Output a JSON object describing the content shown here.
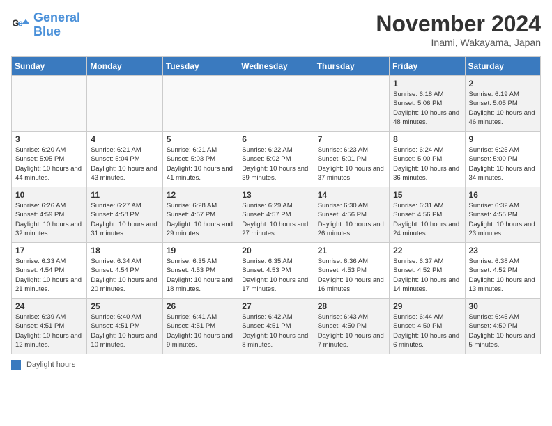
{
  "header": {
    "logo_line1": "General",
    "logo_line2": "Blue",
    "month": "November 2024",
    "location": "Inami, Wakayama, Japan"
  },
  "weekdays": [
    "Sunday",
    "Monday",
    "Tuesday",
    "Wednesday",
    "Thursday",
    "Friday",
    "Saturday"
  ],
  "weeks": [
    [
      {
        "day": "",
        "info": ""
      },
      {
        "day": "",
        "info": ""
      },
      {
        "day": "",
        "info": ""
      },
      {
        "day": "",
        "info": ""
      },
      {
        "day": "",
        "info": ""
      },
      {
        "day": "1",
        "info": "Sunrise: 6:18 AM\nSunset: 5:06 PM\nDaylight: 10 hours and 48 minutes."
      },
      {
        "day": "2",
        "info": "Sunrise: 6:19 AM\nSunset: 5:05 PM\nDaylight: 10 hours and 46 minutes."
      }
    ],
    [
      {
        "day": "3",
        "info": "Sunrise: 6:20 AM\nSunset: 5:05 PM\nDaylight: 10 hours and 44 minutes."
      },
      {
        "day": "4",
        "info": "Sunrise: 6:21 AM\nSunset: 5:04 PM\nDaylight: 10 hours and 43 minutes."
      },
      {
        "day": "5",
        "info": "Sunrise: 6:21 AM\nSunset: 5:03 PM\nDaylight: 10 hours and 41 minutes."
      },
      {
        "day": "6",
        "info": "Sunrise: 6:22 AM\nSunset: 5:02 PM\nDaylight: 10 hours and 39 minutes."
      },
      {
        "day": "7",
        "info": "Sunrise: 6:23 AM\nSunset: 5:01 PM\nDaylight: 10 hours and 37 minutes."
      },
      {
        "day": "8",
        "info": "Sunrise: 6:24 AM\nSunset: 5:00 PM\nDaylight: 10 hours and 36 minutes."
      },
      {
        "day": "9",
        "info": "Sunrise: 6:25 AM\nSunset: 5:00 PM\nDaylight: 10 hours and 34 minutes."
      }
    ],
    [
      {
        "day": "10",
        "info": "Sunrise: 6:26 AM\nSunset: 4:59 PM\nDaylight: 10 hours and 32 minutes."
      },
      {
        "day": "11",
        "info": "Sunrise: 6:27 AM\nSunset: 4:58 PM\nDaylight: 10 hours and 31 minutes."
      },
      {
        "day": "12",
        "info": "Sunrise: 6:28 AM\nSunset: 4:57 PM\nDaylight: 10 hours and 29 minutes."
      },
      {
        "day": "13",
        "info": "Sunrise: 6:29 AM\nSunset: 4:57 PM\nDaylight: 10 hours and 27 minutes."
      },
      {
        "day": "14",
        "info": "Sunrise: 6:30 AM\nSunset: 4:56 PM\nDaylight: 10 hours and 26 minutes."
      },
      {
        "day": "15",
        "info": "Sunrise: 6:31 AM\nSunset: 4:56 PM\nDaylight: 10 hours and 24 minutes."
      },
      {
        "day": "16",
        "info": "Sunrise: 6:32 AM\nSunset: 4:55 PM\nDaylight: 10 hours and 23 minutes."
      }
    ],
    [
      {
        "day": "17",
        "info": "Sunrise: 6:33 AM\nSunset: 4:54 PM\nDaylight: 10 hours and 21 minutes."
      },
      {
        "day": "18",
        "info": "Sunrise: 6:34 AM\nSunset: 4:54 PM\nDaylight: 10 hours and 20 minutes."
      },
      {
        "day": "19",
        "info": "Sunrise: 6:35 AM\nSunset: 4:53 PM\nDaylight: 10 hours and 18 minutes."
      },
      {
        "day": "20",
        "info": "Sunrise: 6:35 AM\nSunset: 4:53 PM\nDaylight: 10 hours and 17 minutes."
      },
      {
        "day": "21",
        "info": "Sunrise: 6:36 AM\nSunset: 4:53 PM\nDaylight: 10 hours and 16 minutes."
      },
      {
        "day": "22",
        "info": "Sunrise: 6:37 AM\nSunset: 4:52 PM\nDaylight: 10 hours and 14 minutes."
      },
      {
        "day": "23",
        "info": "Sunrise: 6:38 AM\nSunset: 4:52 PM\nDaylight: 10 hours and 13 minutes."
      }
    ],
    [
      {
        "day": "24",
        "info": "Sunrise: 6:39 AM\nSunset: 4:51 PM\nDaylight: 10 hours and 12 minutes."
      },
      {
        "day": "25",
        "info": "Sunrise: 6:40 AM\nSunset: 4:51 PM\nDaylight: 10 hours and 10 minutes."
      },
      {
        "day": "26",
        "info": "Sunrise: 6:41 AM\nSunset: 4:51 PM\nDaylight: 10 hours and 9 minutes."
      },
      {
        "day": "27",
        "info": "Sunrise: 6:42 AM\nSunset: 4:51 PM\nDaylight: 10 hours and 8 minutes."
      },
      {
        "day": "28",
        "info": "Sunrise: 6:43 AM\nSunset: 4:50 PM\nDaylight: 10 hours and 7 minutes."
      },
      {
        "day": "29",
        "info": "Sunrise: 6:44 AM\nSunset: 4:50 PM\nDaylight: 10 hours and 6 minutes."
      },
      {
        "day": "30",
        "info": "Sunrise: 6:45 AM\nSunset: 4:50 PM\nDaylight: 10 hours and 5 minutes."
      }
    ]
  ],
  "footer": {
    "legend_label": "Daylight hours"
  }
}
